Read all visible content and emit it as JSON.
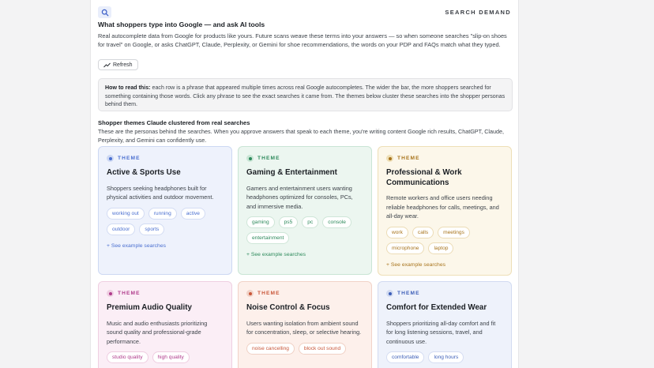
{
  "header": {
    "eyebrow": "SEARCH DEMAND",
    "title": "What shoppers type into Google — and ask AI tools",
    "description": "Real autocomplete data from Google for products like yours. Future scans weave these terms into your answers — so when someone searches \"slip-on shoes for travel\" on Google, or asks ChatGPT, Claude, Perplexity, or Gemini for shoe recommendations, the words on your PDP and FAQs match what they typed.",
    "refresh_label": "Refresh"
  },
  "howto": {
    "lead": "How to read this:",
    "text": " each row is a phrase that appeared multiple times across real Google autocompletes. The wider the bar, the more shoppers searched for something containing those words. Click any phrase to see the exact searches it came from. The themes below cluster these searches into the shopper personas behind them."
  },
  "themes": {
    "title": "Shopper themes Claude clustered from real searches",
    "description": "These are the personas behind the searches. When you approve answers that speak to each theme, you're writing content Google rich results, ChatGPT, Claude, Perplexity, and Gemini can confidently use.",
    "cards": [
      {
        "tag": "THEME",
        "name": "Active & Sports Use",
        "description": "Shoppers seeking headphones built for physical activities and outdoor movement.",
        "chips": [
          "working out",
          "running",
          "active",
          "outdoor",
          "sports"
        ],
        "see_more": "+ See example searches",
        "accent": "#4a6fd0",
        "bg": "#eef2fc",
        "border": "#cdd8f3",
        "chip_border": "#d3dcf3"
      },
      {
        "tag": "THEME",
        "name": "Gaming & Entertainment",
        "description": "Gamers and entertainment users wanting headphones optimized for consoles, PCs, and immersive media.",
        "chips": [
          "gaming",
          "ps5",
          "pc",
          "console",
          "entertainment"
        ],
        "see_more": "+ See example searches",
        "accent": "#2e8a5c",
        "bg": "#ecf6f0",
        "border": "#c9e5d5",
        "chip_border": "#cfe6d8"
      },
      {
        "tag": "THEME",
        "name": "Professional & Work Communications",
        "description": "Remote workers and office users needing reliable headphones for calls, meetings, and all-day wear.",
        "chips": [
          "work",
          "calls",
          "meetings",
          "microphone",
          "laptop"
        ],
        "see_more": "+ See example searches",
        "accent": "#a8741c",
        "bg": "#fcf7ea",
        "border": "#eedfb7",
        "chip_border": "#ecdcb6"
      },
      {
        "tag": "THEME",
        "name": "Premium Audio Quality",
        "description": "Music and audio enthusiasts prioritizing sound quality and professional-grade performance.",
        "chips": [
          "studio quality",
          "high quality"
        ],
        "see_more": "",
        "accent": "#b03c8c",
        "bg": "#fbeef6",
        "border": "#efcfe2",
        "chip_border": "#efcde1"
      },
      {
        "tag": "THEME",
        "name": "Noise Control & Focus",
        "description": "Users wanting isolation from ambient sound for concentration, sleep, or selective hearing.",
        "chips": [
          "noise cancelling",
          "block out sound"
        ],
        "see_more": "",
        "accent": "#c9573a",
        "bg": "#fdf0eb",
        "border": "#f1d3c8",
        "chip_border": "#f0d1c5"
      },
      {
        "tag": "THEME",
        "name": "Comfort for Extended Wear",
        "description": "Shoppers prioritizing all-day comfort and fit for long listening sessions, travel, and continuous use.",
        "chips": [
          "comfortable",
          "long hours"
        ],
        "see_more": "",
        "accent": "#3d5fb8",
        "bg": "#eef2fb",
        "border": "#d2dbf1",
        "chip_border": "#d5ddf2"
      }
    ]
  }
}
